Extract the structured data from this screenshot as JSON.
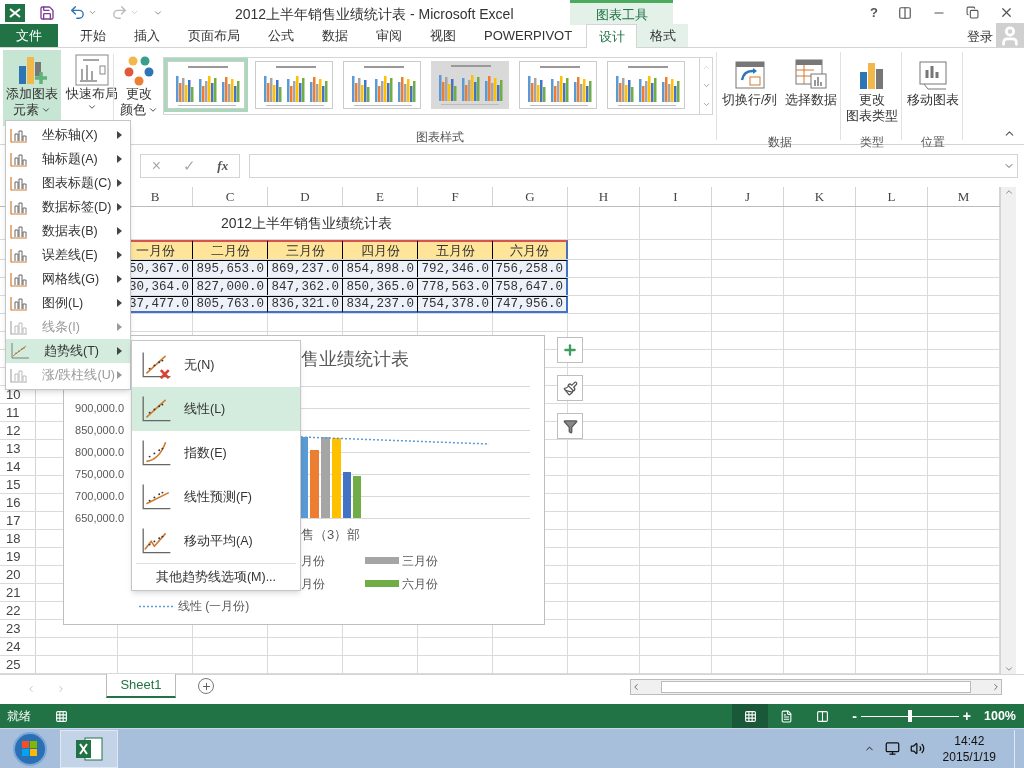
{
  "window": {
    "title": "2012上半年销售业绩统计表 - Microsoft Excel",
    "context_tab": "图表工具",
    "help": "?"
  },
  "tabs": [
    {
      "label": "文件",
      "kind": "file",
      "selected": false
    },
    {
      "label": "开始",
      "kind": "tab",
      "selected": false
    },
    {
      "label": "插入",
      "kind": "tab",
      "selected": false
    },
    {
      "label": "页面布局",
      "kind": "tab",
      "selected": false
    },
    {
      "label": "公式",
      "kind": "tab",
      "selected": false
    },
    {
      "label": "数据",
      "kind": "tab",
      "selected": false
    },
    {
      "label": "审阅",
      "kind": "tab",
      "selected": false
    },
    {
      "label": "视图",
      "kind": "tab",
      "selected": false
    },
    {
      "label": "POWERPIVOT",
      "kind": "tab",
      "selected": false
    },
    {
      "label": "设计",
      "kind": "context",
      "selected": true
    },
    {
      "label": "格式",
      "kind": "context",
      "selected": false
    }
  ],
  "signin": "登录",
  "ribbon": {
    "layout_buttons": [
      {
        "lines": [
          "添加图表",
          "元素"
        ],
        "pressed": true
      },
      {
        "lines": [
          "快速布局"
        ],
        "pressed": false
      },
      {
        "lines": [
          "更改",
          "颜色"
        ],
        "pressed": false
      }
    ],
    "chart_styles": [
      {
        "selected": true
      },
      {
        "selected": false
      },
      {
        "selected": false
      },
      {
        "selected": false
      },
      {
        "selected": false
      },
      {
        "selected": false
      }
    ],
    "styles_label": "图表样式",
    "groups": [
      {
        "label": "数据",
        "buttons": [
          {
            "lines": [
              "切换行/列"
            ],
            "kind": "switch"
          },
          {
            "lines": [
              "选择数据"
            ],
            "kind": "select"
          }
        ]
      },
      {
        "label": "类型",
        "buttons": [
          {
            "lines": [
              "更改",
              "图表类型"
            ],
            "kind": "type"
          }
        ]
      },
      {
        "label": "位置",
        "buttons": [
          {
            "lines": [
              "移动图表"
            ],
            "kind": "move"
          }
        ]
      }
    ]
  },
  "formula_bar": {
    "cancel": "×",
    "enter": "✓",
    "fx": "fx"
  },
  "columns": [
    "B",
    "C",
    "D",
    "E",
    "F",
    "G",
    "H",
    "I",
    "J",
    "K",
    "L",
    "M"
  ],
  "sheet": {
    "title": "2012上半年销售业绩统计表",
    "header": [
      "一月份",
      "二月份",
      "三月份",
      "四月份",
      "五月份",
      "六月份"
    ],
    "rows": [
      [
        "50,367.0",
        "895,653.0",
        "869,237.0",
        "854,898.0",
        "792,346.0",
        "756,258.0"
      ],
      [
        "30,364.0",
        "827,000.0",
        "847,362.0",
        "850,365.0",
        "778,563.0",
        "758,647.0"
      ],
      [
        "37,477.0",
        "805,763.0",
        "836,321.0",
        "834,237.0",
        "754,378.0",
        "747,956.0"
      ]
    ],
    "row_numbers": [
      "10",
      "11",
      "12",
      "13",
      "14",
      "15",
      "16",
      "17",
      "18",
      "19",
      "20",
      "21",
      "22",
      "23",
      "24",
      "25"
    ]
  },
  "chart": {
    "title": "售业绩统计表",
    "y_axis_labels": [
      "900,000.0",
      "850,000.0",
      "800,000.0",
      "750,000.0",
      "700,000.0",
      "650,000.0"
    ],
    "category": "售（3）部",
    "legend": [
      {
        "label": "月份"
      },
      {
        "label": "三月份",
        "color": "#a5a5a5"
      },
      {
        "label": "月份"
      },
      {
        "label": "六月份",
        "color": "#70ad47"
      }
    ],
    "trend_legend": "线性 (一月份)"
  },
  "menu": [
    {
      "label": "坐标轴(X)",
      "disabled": false,
      "selected": false
    },
    {
      "label": "轴标题(A)",
      "disabled": false,
      "selected": false
    },
    {
      "label": "图表标题(C)",
      "disabled": false,
      "selected": false
    },
    {
      "label": "数据标签(D)",
      "disabled": false,
      "selected": false
    },
    {
      "label": "数据表(B)",
      "disabled": false,
      "selected": false
    },
    {
      "label": "误差线(E)",
      "disabled": false,
      "selected": false
    },
    {
      "label": "网格线(G)",
      "disabled": false,
      "selected": false
    },
    {
      "label": "图例(L)",
      "disabled": false,
      "selected": false
    },
    {
      "label": "线条(I)",
      "disabled": true,
      "selected": false
    },
    {
      "label": "趋势线(T)",
      "disabled": false,
      "selected": true
    },
    {
      "label": "涨/跌柱线(U)",
      "disabled": true,
      "selected": false
    }
  ],
  "submenu": {
    "items": [
      {
        "label": "无(N)",
        "kind": "none",
        "selected": false
      },
      {
        "label": "线性(L)",
        "kind": "linear",
        "selected": true
      },
      {
        "label": "指数(E)",
        "kind": "exp",
        "selected": false
      },
      {
        "label": "线性预测(F)",
        "kind": "forecast",
        "selected": false
      },
      {
        "label": "移动平均(A)",
        "kind": "average",
        "selected": false
      }
    ],
    "more": "其他趋势线选项(M)..."
  },
  "sheets": [
    {
      "label": "Sheet1",
      "selected": true
    }
  ],
  "status_bar": {
    "text": "就绪",
    "views": [
      {
        "selected": true
      },
      {
        "selected": false
      },
      {
        "selected": false
      }
    ],
    "zoom": {
      "minus": "-",
      "plus": "+",
      "level": 0.5,
      "value": "100%"
    }
  },
  "taskbar": {
    "time": "14:42",
    "date": "2015/1/19"
  }
}
